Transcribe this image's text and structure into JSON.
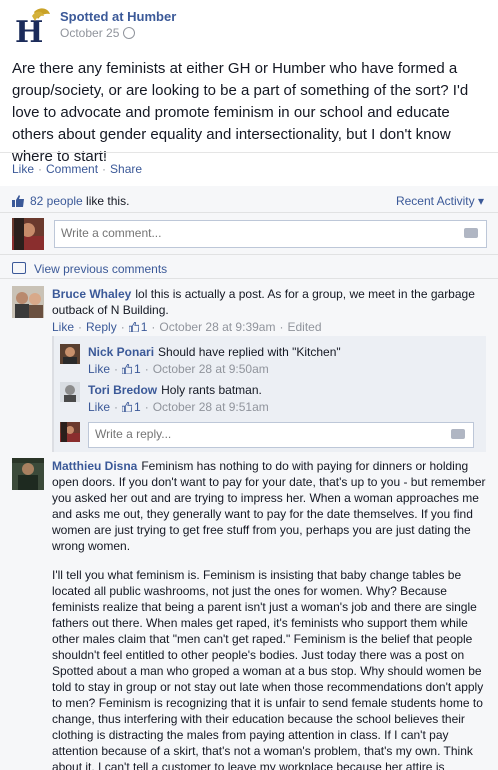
{
  "post": {
    "page_name": "Spotted at Humber",
    "date": "October 25",
    "text": "Are there any feminists at either GH or Humber who have formed a group/society, or are looking to be a part of something of the sort? I'd love to advocate and promote feminism in our school and educate others about gender equality and intersectionality, but I don't know where to start!",
    "actions": [
      "Like",
      "Comment",
      "Share"
    ]
  },
  "ufi": {
    "likes_count": "82 people",
    "likes_suffix": " like this.",
    "recent_activity": "Recent Activity ▾",
    "comment_placeholder": "Write a comment...",
    "view_previous": "View previous comments"
  },
  "comments": [
    {
      "author": "Bruce Whaley",
      "text": "lol this is actually a post. As for a group, we meet in the garbage outback of N Building.",
      "meta": {
        "like": "Like",
        "reply": "Reply",
        "likes": "1",
        "time": "October 28 at 9:39am",
        "edited": "Edited"
      },
      "replies": [
        {
          "author": "Nick Ponari",
          "text": "Should have replied with \"Kitchen\"",
          "meta": {
            "like": "Like",
            "likes": "1",
            "time": "October 28 at 9:50am"
          }
        },
        {
          "author": "Tori Bredow",
          "text": "Holy rants batman.",
          "meta": {
            "like": "Like",
            "likes": "1",
            "time": "October 28 at 9:51am"
          }
        }
      ],
      "reply_placeholder": "Write a reply..."
    },
    {
      "author": "Matthieu Disna",
      "paragraphs": [
        "Feminism has nothing to do with paying for dinners or holding open doors. If you don't want to pay for your date, that's up to you - but remember you asked her out and are trying to impress her. When a woman approaches me and asks me out, they generally want to pay for the date themselves. If you find women are just trying to get free stuff from you, perhaps you are just dating the wrong women.",
        "I'll tell you what feminism is. Feminism is insisting that baby change tables be located all public washrooms, not just the ones for women. Why? Because feminists realize that being a parent isn't just a woman's job and there are single fathers out there. When males get raped, it's feminists who support them while other males claim that \"men can't get raped.\" Feminism is the belief that people shouldn't feel entitled to other people's bodies. Just today there was a post on Spotted about a man who groped a woman at a bus stop. Why should women be told to stay in group or not stay out late when those recommendations don't apply to men? Feminism is recognizing that it is unfair to send female students home to change, thus interfering with their education because the school believes their clothing is distracting the males from paying attention in class. If I can't pay attention because of a skirt, that's not a woman's problem, that's my own. Think about it, I can't tell a customer to leave my workplace because her attire is distracting me from work."
      ]
    }
  ],
  "colors": {
    "link": "#3b5998",
    "muted": "#90949c",
    "ufi_bg": "#f6f7f9"
  }
}
